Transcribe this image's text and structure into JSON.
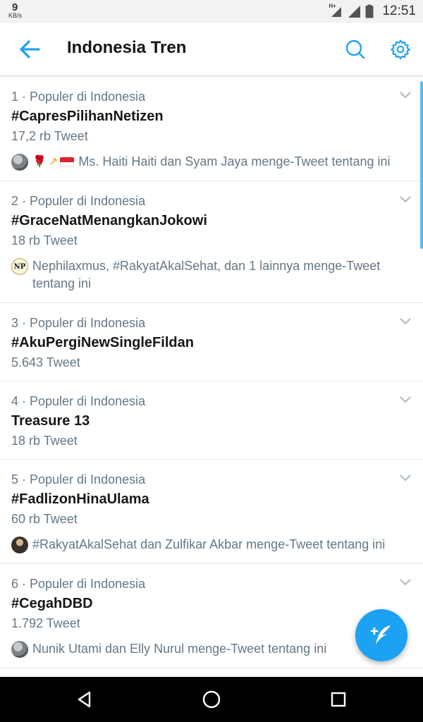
{
  "status_bar": {
    "speed_value": "9",
    "speed_unit": "KB/s",
    "network": "H+",
    "time": "12:51"
  },
  "header": {
    "title": "Indonesia Tren",
    "icons": [
      "back-arrow-icon",
      "search-icon",
      "settings-gear-icon"
    ],
    "accent_color": "#1da1f2"
  },
  "trends": [
    {
      "meta": "1 · Populer di Indonesia",
      "name": "#CapresPilihanNetizen",
      "count": "17,2 rb Tweet",
      "context": "Ms. Haiti Haiti dan Syam Jaya menge-Tweet tentang ini"
    },
    {
      "meta": "2 · Populer di Indonesia",
      "name": "#GraceNatMenangkanJokowi",
      "count": "18 rb Tweet",
      "context": "Nephilaxmus, #RakyatAkalSehat, dan 1 lainnya menge-Tweet tentang ini",
      "avatar_text": "NP"
    },
    {
      "meta": "3 · Populer di Indonesia",
      "name": "#AkuPergiNewSingleFildan",
      "count": "5.643 Tweet"
    },
    {
      "meta": "4 · Populer di Indonesia",
      "name": "Treasure 13",
      "count": "18 rb Tweet"
    },
    {
      "meta": "5 · Populer di Indonesia",
      "name": "#FadlizonHinaUlama",
      "count": "60 rb Tweet",
      "context": "#RakyatAkalSehat dan Zulfikar Akbar menge-Tweet tentang ini"
    },
    {
      "meta": "6 · Populer di Indonesia",
      "name": "#CegahDBD",
      "count": "1.792 Tweet",
      "context": "Nunik Utami dan Elly Nurul menge-Tweet tentang ini"
    }
  ],
  "fab": {
    "icon": "compose-feather-plus-icon"
  },
  "nav": {
    "icons": [
      "back-triangle-icon",
      "home-circle-icon",
      "recents-square-icon"
    ]
  }
}
